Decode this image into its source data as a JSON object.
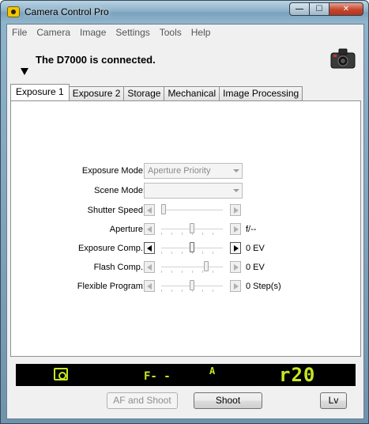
{
  "window": {
    "title": "Camera Control Pro",
    "min_label": "—",
    "max_label": "☐",
    "close_label": "✕"
  },
  "menu": [
    "File",
    "Camera",
    "Image",
    "Settings",
    "Tools",
    "Help"
  ],
  "status": {
    "text": "The D7000 is connected."
  },
  "tabs": [
    "Exposure 1",
    "Exposure 2",
    "Storage",
    "Mechanical",
    "Image Processing"
  ],
  "active_tab": "Exposure 1",
  "controls": {
    "exposure_mode": {
      "label": "Exposure Mode:",
      "value": "Aperture Priority"
    },
    "scene_mode": {
      "label": "Scene Mode:",
      "value": ""
    },
    "shutter_speed": {
      "label": "Shutter Speed:",
      "value": ""
    },
    "aperture": {
      "label": "Aperture:",
      "value": "f/--"
    },
    "exposure_comp": {
      "label": "Exposure Comp.:",
      "value": "0 EV"
    },
    "flash_comp": {
      "label": "Flash Comp.:",
      "value": "0 EV"
    },
    "flexible_program": {
      "label": "Flexible Program:",
      "value": "0 Step(s)"
    }
  },
  "lcd": {
    "f_display": "F- -",
    "mode": "A",
    "remaining": "r20",
    "color": "#c8e620"
  },
  "buttons": {
    "af_shoot": "AF and Shoot",
    "shoot": "Shoot",
    "lv": "Lv"
  },
  "icons": {
    "app": "camera-control-app-icon",
    "camera": "camera-icon",
    "flash": "flash-indicator-icon"
  }
}
